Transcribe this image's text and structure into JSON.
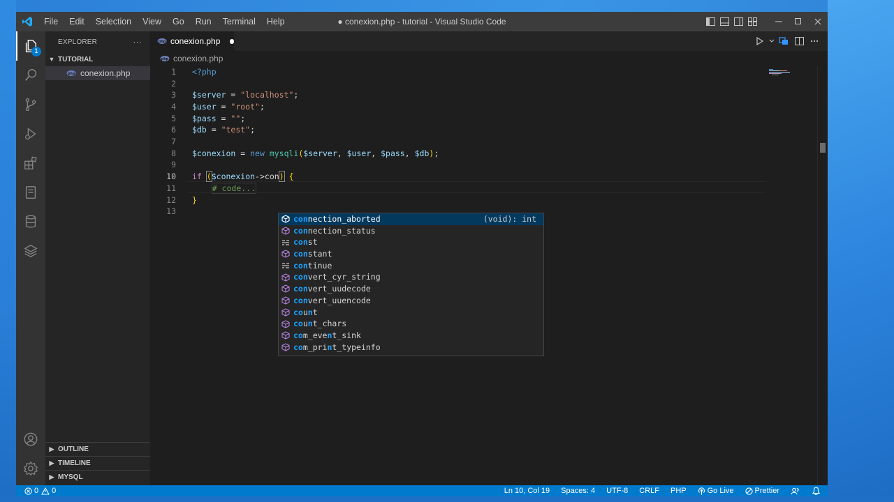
{
  "window": {
    "title": "● conexion.php - tutorial - Visual Studio Code"
  },
  "menu": [
    "File",
    "Edit",
    "Selection",
    "View",
    "Go",
    "Run",
    "Terminal",
    "Help"
  ],
  "activity_bar": {
    "explorer_badge": "1",
    "icons": [
      "explorer-icon",
      "search-icon",
      "source-control-icon",
      "run-debug-icon",
      "extensions-icon",
      "notebook-icon",
      "database-icon",
      "layers-icon",
      "account-icon",
      "settings-gear-icon"
    ]
  },
  "sidebar": {
    "title": "EXPLORER",
    "more": "···",
    "folder": "TUTORIAL",
    "files": [
      "conexion.php"
    ],
    "sections": [
      "OUTLINE",
      "TIMELINE",
      "MYSQL"
    ]
  },
  "editor": {
    "tab_label": "conexion.php",
    "breadcrumb": "conexion.php",
    "line_numbers": [
      "1",
      "2",
      "3",
      "4",
      "5",
      "6",
      "7",
      "8",
      "9",
      "10",
      "11",
      "12",
      "13"
    ],
    "current_line": "10"
  },
  "suggest": {
    "detail": "(void): int",
    "items": [
      {
        "match": "con",
        "rest": "nection_aborted",
        "kind": "method"
      },
      {
        "match": "con",
        "rest": "nection_status",
        "kind": "method"
      },
      {
        "match": "con",
        "rest": "st",
        "kind": "keyword"
      },
      {
        "match": "con",
        "rest": "stant",
        "kind": "method"
      },
      {
        "match": "con",
        "rest": "tinue",
        "kind": "keyword"
      },
      {
        "match": "con",
        "rest": "vert_cyr_string",
        "kind": "method"
      },
      {
        "match": "con",
        "rest": "vert_uudecode",
        "kind": "method"
      },
      {
        "match": "con",
        "rest": "vert_uuencode",
        "kind": "method"
      },
      {
        "match": "co",
        "rest": "u",
        "match2": "n",
        "rest2": "t",
        "kind": "method"
      },
      {
        "match": "co",
        "rest": "u",
        "match2": "n",
        "rest2": "t_chars",
        "kind": "method"
      },
      {
        "match": "co",
        "rest": "m_eve",
        "match2": "n",
        "rest2": "t_sink",
        "kind": "method"
      },
      {
        "match": "co",
        "rest": "m_pri",
        "match2": "n",
        "rest2": "t_typeinfo",
        "kind": "method"
      }
    ]
  },
  "statusbar": {
    "errors": "0",
    "warnings": "0",
    "position": "Ln 10, Col 19",
    "spaces": "Spaces: 4",
    "encoding": "UTF-8",
    "eol": "CRLF",
    "language": "PHP",
    "go_live": "Go Live",
    "prettier": "Prettier"
  },
  "colors": {
    "accent": "#007acc",
    "titlebar": "#3c3c3c",
    "editor_bg": "#1e1e1e"
  }
}
